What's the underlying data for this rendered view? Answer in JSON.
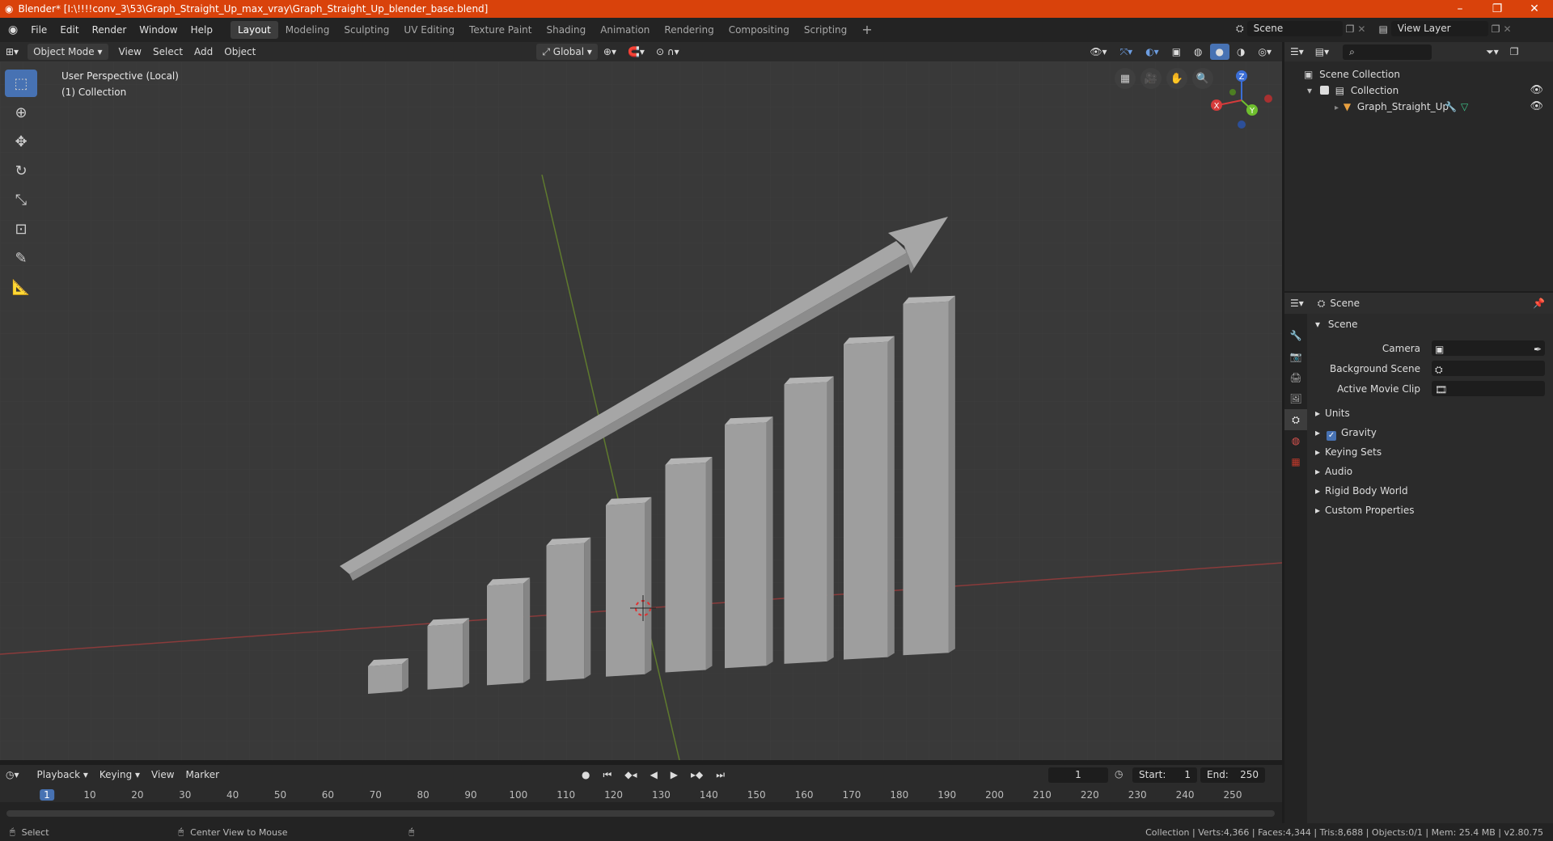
{
  "titlebar": {
    "title": "Blender* [I:\\!!!!conv_3\\53\\Graph_Straight_Up_max_vray\\Graph_Straight_Up_blender_base.blend]"
  },
  "menu": {
    "file": "File",
    "edit": "Edit",
    "render": "Render",
    "window": "Window",
    "help": "Help"
  },
  "workspaces": [
    "Layout",
    "Modeling",
    "Sculpting",
    "UV Editing",
    "Texture Paint",
    "Shading",
    "Animation",
    "Rendering",
    "Compositing",
    "Scripting"
  ],
  "active_workspace": "Layout",
  "top_right": {
    "scene": "Scene",
    "view_layer": "View Layer"
  },
  "viewport_header": {
    "mode": "Object Mode",
    "view": "View",
    "select": "Select",
    "add": "Add",
    "object": "Object",
    "transform": "Global"
  },
  "viewport": {
    "perspective": "User Perspective (Local)",
    "collection": "(1) Collection"
  },
  "gizmo": {
    "x": "X",
    "y": "Y",
    "z": "Z"
  },
  "outliner": {
    "root": "Scene Collection",
    "collection": "Collection",
    "object": "Graph_Straight_Up",
    "search_placeholder": ""
  },
  "properties": {
    "context": "Scene",
    "panel_title": "Scene",
    "camera_label": "Camera",
    "background_scene_label": "Background Scene",
    "active_movie_clip_label": "Active Movie Clip",
    "sections": [
      "Units",
      "Gravity",
      "Keying Sets",
      "Audio",
      "Rigid Body World",
      "Custom Properties"
    ],
    "gravity_checked": true
  },
  "timeline": {
    "playback": "Playback",
    "keying": "Keying",
    "view": "View",
    "marker": "Marker",
    "current_frame": "1",
    "start_label": "Start:",
    "start": "1",
    "end_label": "End:",
    "end": "250",
    "ticks": [
      "1",
      "10",
      "20",
      "30",
      "40",
      "50",
      "60",
      "70",
      "80",
      "90",
      "100",
      "110",
      "120",
      "130",
      "140",
      "150",
      "160",
      "170",
      "180",
      "190",
      "200",
      "210",
      "220",
      "230",
      "240",
      "250"
    ]
  },
  "status": {
    "select": "Select",
    "center_view": "Center View to Mouse",
    "stats": "Collection | Verts:4,366 | Faces:4,344 | Tris:8,688 | Objects:0/1 | Mem: 25.4 MB | v2.80.75"
  },
  "colors": {
    "title_bg": "#d9420b",
    "accent": "#4772b3",
    "bars": "#9a9a9a"
  }
}
